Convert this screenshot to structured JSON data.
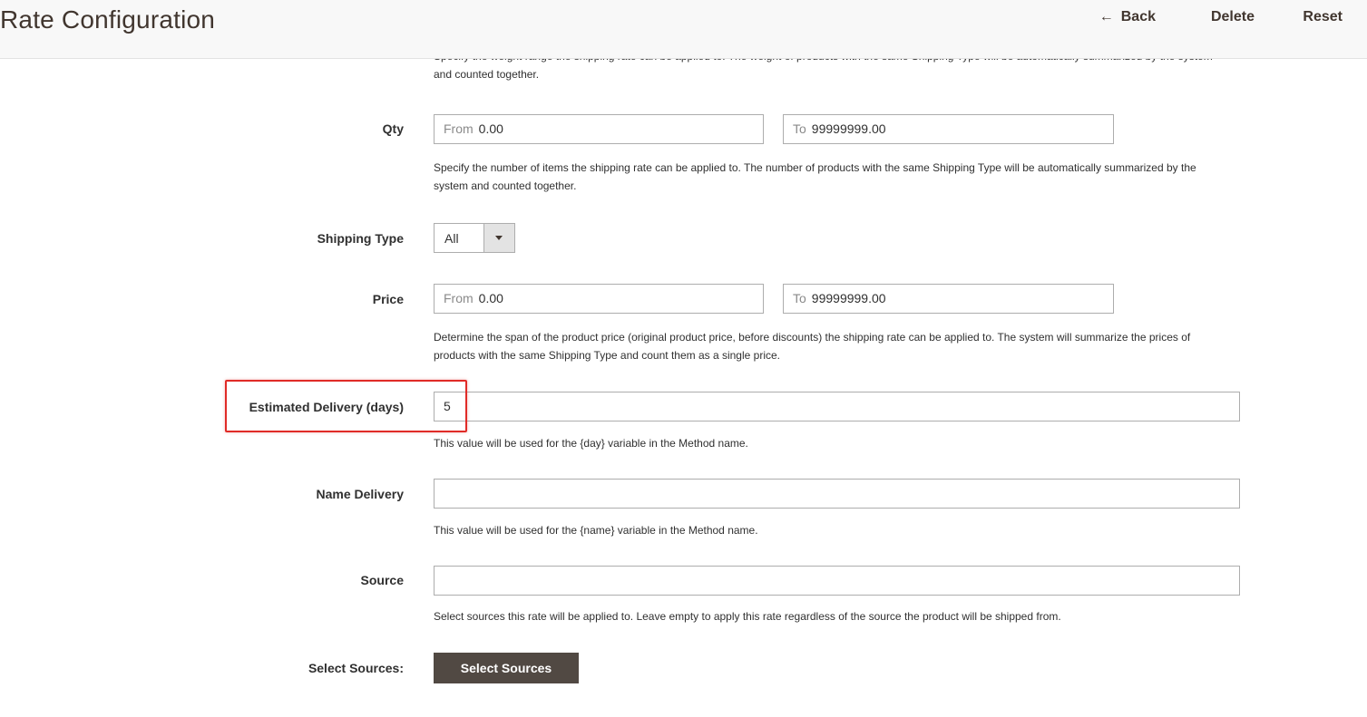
{
  "header": {
    "title": "Rate Configuration",
    "actions": {
      "back_label": "Back",
      "delete_label": "Delete",
      "reset_label": "Reset"
    }
  },
  "weight": {
    "note": "Specify the weight range the shipping rate can be applied to. The weight of products with the same Shipping Type will be automatically summarized by the system and counted together."
  },
  "qty": {
    "label": "Qty",
    "from_prefix": "From",
    "from_value": "0.00",
    "to_prefix": "To",
    "to_value": "99999999.00",
    "note": "Specify the number of items the shipping rate can be applied to. The number of products with the same Shipping Type will be automatically summarized by the system and counted together."
  },
  "shipping_type": {
    "label": "Shipping Type",
    "selected": "All"
  },
  "price": {
    "label": "Price",
    "from_prefix": "From",
    "from_value": "0.00",
    "to_prefix": "To",
    "to_value": "99999999.00",
    "note": "Determine the span of the product price (original product price, before discounts) the shipping rate can be applied to. The system will summarize the prices of products with the same Shipping Type and count them as a single price."
  },
  "estimated_delivery": {
    "label": "Estimated Delivery (days)",
    "value": "5",
    "note": "This value will be used for the {day} variable in the Method name.",
    "highlight_color": "#e02b27"
  },
  "name_delivery": {
    "label": "Name Delivery",
    "value": "",
    "note": "This value will be used for the {name} variable in the Method name."
  },
  "source": {
    "label": "Source",
    "value": "",
    "note": "Select sources this rate will be applied to. Leave empty to apply this rate regardless of the source the product will be shipped from."
  },
  "select_sources": {
    "label": "Select Sources:",
    "button_label": "Select Sources"
  },
  "colors": {
    "header_bg": "#f8f8f8",
    "button_dark": "#514943",
    "title": "#41362f"
  }
}
